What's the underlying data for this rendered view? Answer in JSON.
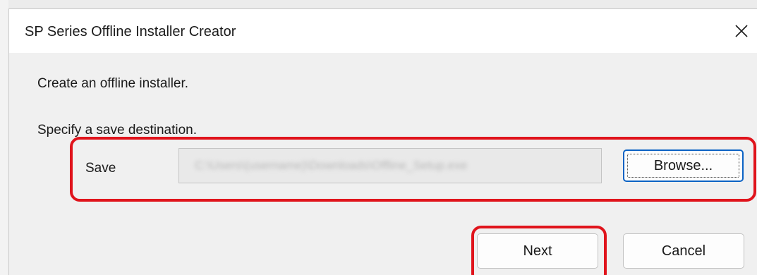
{
  "dialog": {
    "title": "SP Series Offline Installer Creator",
    "close_glyph": "×",
    "intro_text": "Create an offline installer.",
    "instruction_text": "Specify a save destination."
  },
  "save": {
    "label": "Save",
    "path_value": "C:\\Users\\(username)\\Downloads\\Offline_Setup.exe",
    "browse_label": "Browse..."
  },
  "actions": {
    "next_label": "Next",
    "cancel_label": "Cancel"
  },
  "colors": {
    "highlight": "#e0141c",
    "focus_border": "#0b62c4"
  },
  "icons": {
    "close": "close-icon"
  }
}
